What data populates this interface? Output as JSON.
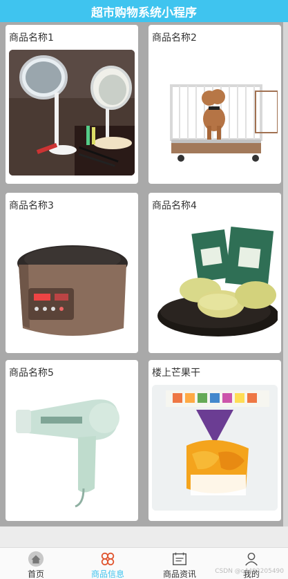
{
  "header": {
    "title": "超市购物系统小程序"
  },
  "products": [
    {
      "name": "商品名称1",
      "image": "vanity-mirror-lamp"
    },
    {
      "name": "商品名称2",
      "image": "dog-crate"
    },
    {
      "name": "商品名称3",
      "image": "rice-cooker"
    },
    {
      "name": "商品名称4",
      "image": "pastry-snacks"
    },
    {
      "name": "商品名称5",
      "image": "hair-dryer"
    },
    {
      "name": "楼上芒果干",
      "image": "dried-mango-pack"
    }
  ],
  "tabbar": {
    "items": [
      {
        "label": "首页",
        "icon": "home-icon"
      },
      {
        "label": "商品信息",
        "icon": "grid-icon",
        "active": true
      },
      {
        "label": "商品资讯",
        "icon": "news-icon"
      },
      {
        "label": "我的",
        "icon": "user-icon"
      }
    ]
  },
  "watermark": "CSDN @c4492205490",
  "colors": {
    "accent": "#3fc4ef",
    "background": "#a9a9a9"
  }
}
